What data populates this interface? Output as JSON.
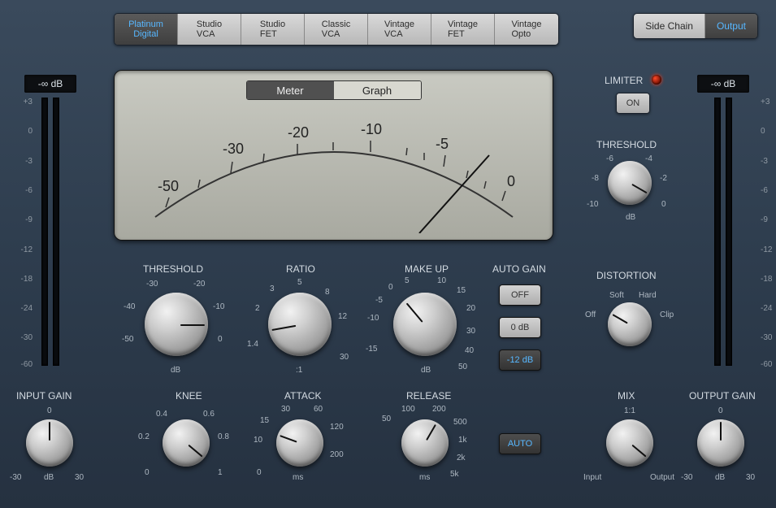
{
  "presets": [
    "Platinum Digital",
    "Studio VCA",
    "Studio FET",
    "Classic VCA",
    "Vintage VCA",
    "Vintage FET",
    "Vintage Opto"
  ],
  "preset_active": 0,
  "sidechain": {
    "a": "Side Chain",
    "b": "Output",
    "active": 1
  },
  "vu": {
    "meter": "Meter",
    "graph": "Graph",
    "active": 0,
    "scale": [
      "-50",
      "-30",
      "-20",
      "-10",
      "-5",
      "0"
    ]
  },
  "limiter": {
    "label": "LIMITER",
    "on": "ON",
    "threshold_label": "THRESHOLD",
    "ticks": [
      "-6",
      "-4",
      "-2",
      "-8",
      "0",
      "-10",
      "dB"
    ],
    "unit": "dB"
  },
  "distortion": {
    "label": "DISTORTION",
    "ticks": [
      "Soft",
      "Hard",
      "Off",
      "Clip"
    ]
  },
  "mix": {
    "label": "MIX",
    "ticks": [
      "1:1",
      "Input",
      "Output"
    ]
  },
  "output_gain": {
    "label": "OUTPUT GAIN",
    "ticks": [
      "0",
      "-30",
      "30"
    ],
    "unit": "dB"
  },
  "input_gain": {
    "label": "INPUT GAIN",
    "ticks": [
      "0",
      "-30",
      "30"
    ],
    "unit": "dB"
  },
  "threshold": {
    "label": "THRESHOLD",
    "ticks": [
      "-30",
      "-20",
      "-10",
      "-40",
      "0",
      "-50"
    ],
    "unit": "dB"
  },
  "ratio": {
    "label": "RATIO",
    "ticks": [
      "5",
      "3",
      "8",
      "2",
      "12",
      "1.4",
      "30"
    ],
    "unit": ":1"
  },
  "makeup": {
    "label": "MAKE UP",
    "ticks": [
      "5",
      "0",
      "10",
      "-5",
      "15",
      "-10",
      "20",
      "30",
      "-15",
      "40",
      "50"
    ],
    "unit": "dB"
  },
  "autogain": {
    "label": "AUTO GAIN",
    "off": "OFF",
    "zero": "0 dB",
    "minus12": "-12 dB",
    "auto": "AUTO"
  },
  "knee": {
    "label": "KNEE",
    "ticks": [
      "0.4",
      "0.6",
      "0.2",
      "0.8",
      "0",
      "1"
    ]
  },
  "attack": {
    "label": "ATTACK",
    "ticks": [
      "30",
      "15",
      "60",
      "10",
      "120",
      "200",
      "0"
    ],
    "unit": "ms"
  },
  "release": {
    "label": "RELEASE",
    "ticks": [
      "100",
      "50",
      "200",
      "500",
      "1k",
      "2k",
      "5k"
    ],
    "unit": "ms"
  },
  "vmeter": {
    "readout": "-∞ dB",
    "scale": [
      "+3",
      "0",
      "-3",
      "-6",
      "-9",
      "-12",
      "-18",
      "-24",
      "-30",
      "-60"
    ]
  }
}
